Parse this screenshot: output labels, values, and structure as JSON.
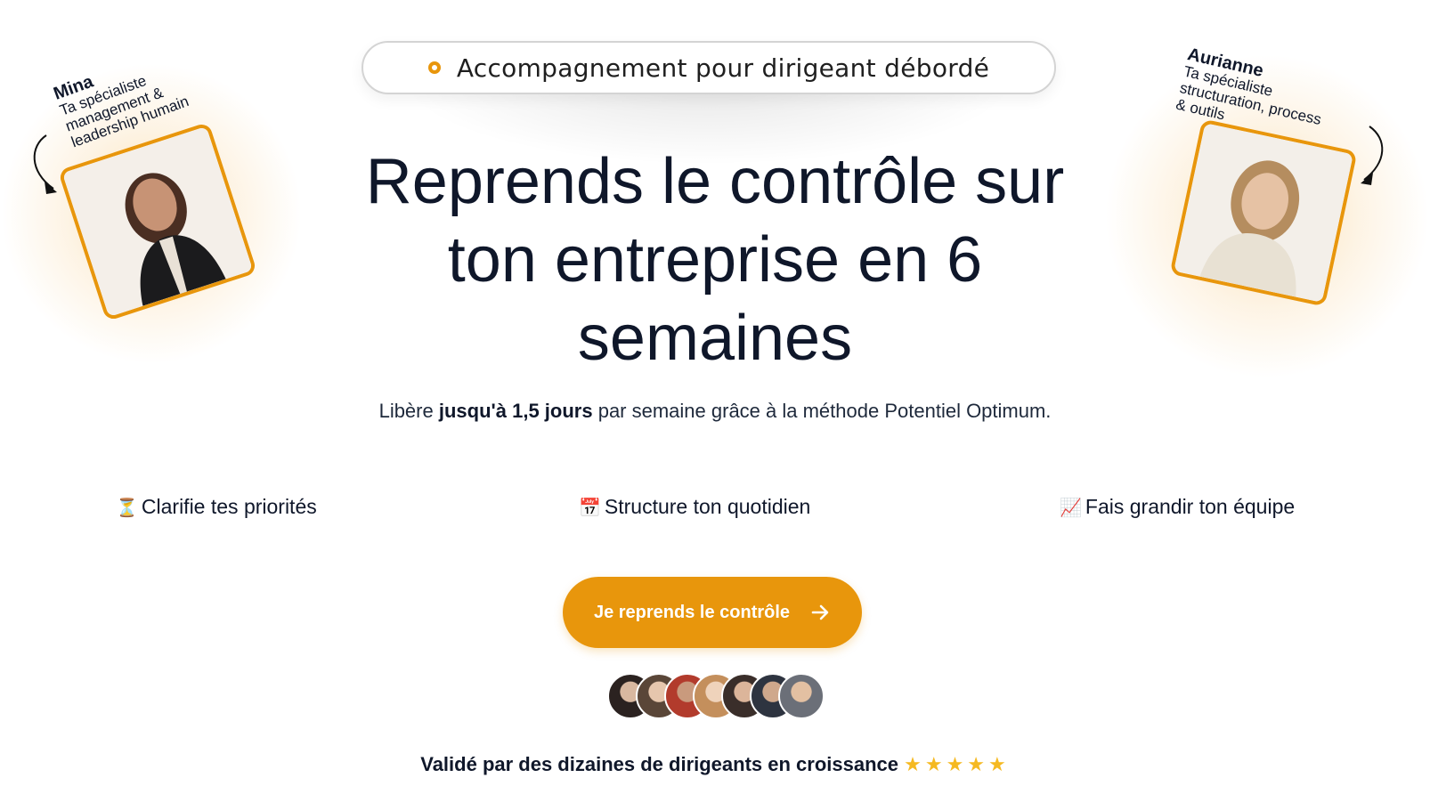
{
  "badge": {
    "text": "Accompagnement pour dirigeant débordé"
  },
  "headline": {
    "text": "Reprends le contrôle sur ton entreprise en 6 semaines"
  },
  "subtitle": {
    "pre": "Libère ",
    "bold": "jusqu'à 1,5 jours",
    "post": " par semaine grâce à la méthode Potentiel Optimum."
  },
  "features": [
    {
      "icon": "⏳",
      "icon_name": "hourglass-icon",
      "label": "Clarifie tes priorités"
    },
    {
      "icon": "📅",
      "icon_name": "calendar-icon",
      "label": "Structure ton quotidien"
    },
    {
      "icon": "📈",
      "icon_name": "chart-increasing-icon",
      "label": "Fais grandir ton équipe"
    }
  ],
  "cta": {
    "label": "Je reprends le contrôle",
    "icon_name": "arrow-right-icon"
  },
  "social_proof": {
    "text": "Validé par des dizaines de dirigeants en croissance",
    "stars": "★★★★★",
    "avatar_count": 7
  },
  "team": [
    {
      "name": "Mina",
      "lines": [
        "Ta spécialiste",
        "management &",
        "leadership humain"
      ]
    },
    {
      "name": "Aurianne",
      "lines": [
        "Ta spécialiste",
        "structuration, process",
        "& outils"
      ]
    }
  ],
  "colors": {
    "accent": "#e8960c",
    "text": "#0f172a",
    "star": "#f5b921"
  }
}
